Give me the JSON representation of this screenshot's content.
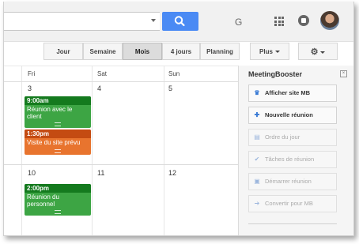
{
  "topbar": {
    "apps_letter": "G",
    "icons": [
      "dropdown-caret",
      "search-icon",
      "apps-grid-icon",
      "notifications-icon",
      "avatar"
    ]
  },
  "views": {
    "day": "Jour",
    "week": "Semaine",
    "month": "Mois",
    "four_days": "4 jours",
    "agenda": "Planning",
    "more": "Plus",
    "active": "Mois"
  },
  "calendar": {
    "day_headers": [
      "Fri",
      "Sat",
      "Sun"
    ],
    "week1_days": [
      "3",
      "4",
      "5"
    ],
    "week2_days": [
      "10",
      "11",
      "12"
    ],
    "events": [
      {
        "time": "9:00am",
        "title": "Réunion avec le client",
        "color": "#3da544"
      },
      {
        "time": "1:30pm",
        "title": "Visite du site prévu",
        "color": "#e8742e"
      },
      {
        "time": "2:00pm",
        "title": "Réunion du personnel",
        "color": "#3da544"
      }
    ]
  },
  "panel": {
    "title": "MeetingBooster",
    "buttons": [
      {
        "label": "Afficher site MB",
        "icon": "crown-icon",
        "enabled": true
      },
      {
        "label": "Nouvelle réunion",
        "icon": "plus-icon",
        "enabled": true
      },
      {
        "label": "Ordre du jour",
        "icon": "agenda-icon",
        "enabled": false
      },
      {
        "label": "Tâches de réunion",
        "icon": "check-icon",
        "enabled": false
      },
      {
        "label": "Démarrer réunion",
        "icon": "play-icon",
        "enabled": false
      },
      {
        "label": "Convertir pour MB",
        "icon": "arrow-right-icon",
        "enabled": false
      }
    ]
  },
  "colors": {
    "accent_blue": "#4a8af4",
    "event_green": "#3da544",
    "event_orange": "#e8742e"
  }
}
